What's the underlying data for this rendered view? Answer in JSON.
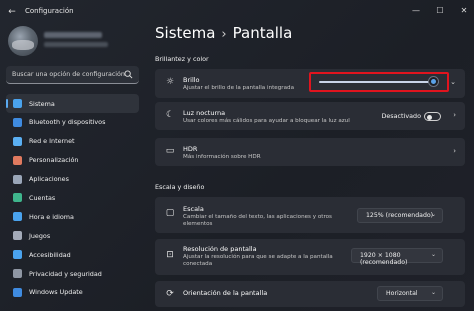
{
  "window": {
    "title": "Configuración",
    "back_glyph": "←",
    "min_glyph": "—",
    "max_glyph": "☐",
    "close_glyph": "✕"
  },
  "search": {
    "placeholder": "Buscar una opción de configuración"
  },
  "sidebar": {
    "items": [
      {
        "label": "Sistema",
        "icon": "system-icon",
        "color": "#4aa3ee",
        "active": true
      },
      {
        "label": "Bluetooth y dispositivos",
        "icon": "bluetooth-icon",
        "color": "#3f8be0",
        "active": false
      },
      {
        "label": "Red e Internet",
        "icon": "network-icon",
        "color": "#5aaff2",
        "active": false
      },
      {
        "label": "Personalización",
        "icon": "brush-icon",
        "color": "#e07a5f",
        "active": false
      },
      {
        "label": "Aplicaciones",
        "icon": "apps-icon",
        "color": "#9aa6b8",
        "active": false
      },
      {
        "label": "Cuentas",
        "icon": "account-icon",
        "color": "#3fb58c",
        "active": false
      },
      {
        "label": "Hora e idioma",
        "icon": "clock-globe-icon",
        "color": "#4aa3ee",
        "active": false
      },
      {
        "label": "Juegos",
        "icon": "gamepad-icon",
        "color": "#a3aab8",
        "active": false
      },
      {
        "label": "Accesibilidad",
        "icon": "accessibility-icon",
        "color": "#4aa3ee",
        "active": false
      },
      {
        "label": "Privacidad y seguridad",
        "icon": "shield-icon",
        "color": "#8f97a4",
        "active": false
      },
      {
        "label": "Windows Update",
        "icon": "update-icon",
        "color": "#3f8be0",
        "active": false
      }
    ]
  },
  "page": {
    "breadcrumb_parent": "Sistema",
    "breadcrumb_sep": "›",
    "title": "Pantalla"
  },
  "sections": {
    "brightness_color": "Brillantez y color",
    "scale_layout": "Escala y diseño"
  },
  "settings": {
    "brightness": {
      "title": "Brillo",
      "subtitle": "Ajustar el brillo de la pantalla integrada",
      "value": 0.95
    },
    "night_light": {
      "title": "Luz nocturna",
      "subtitle": "Usar colores más cálidos para ayudar a bloquear la luz azul",
      "state": "Desactivado"
    },
    "hdr": {
      "title": "HDR",
      "subtitle": "Más información sobre HDR"
    },
    "scale": {
      "title": "Escala",
      "subtitle_1": "Cambiar el tamaño del texto, las aplicaciones y otros",
      "subtitle_2": "elementos",
      "value": "125% (recomendado)"
    },
    "resolution": {
      "title": "Resolución de pantalla",
      "subtitle_1": "Ajustar la resolución para que se adapte a la pantalla",
      "subtitle_2": "conectada",
      "value": "1920 × 1080 (recomendado)"
    },
    "orientation": {
      "title": "Orientación de la pantalla",
      "value": "Horizontal"
    }
  },
  "glyphs": {
    "chevron_right": "›",
    "chevron_down": "⌄",
    "sun": "☼",
    "moon": "☾",
    "hdr": "▭",
    "scale": "▢",
    "resolution": "⊡",
    "orientation": "⟳"
  }
}
